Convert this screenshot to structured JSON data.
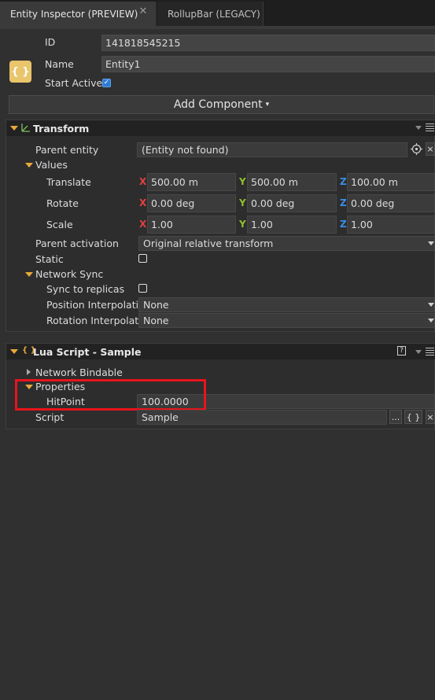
{
  "tabs": [
    {
      "label": "Entity Inspector (PREVIEW)",
      "close": "✕"
    },
    {
      "label": "RollupBar (LEGACY)"
    }
  ],
  "entity": {
    "icon": "{ }",
    "id_label": "ID",
    "id_value": "141818545215",
    "name_label": "Name",
    "name_value": "Entity1",
    "start_active_label": "Start Active",
    "start_active_checked": true
  },
  "add_component": {
    "label": "Add Component",
    "arrow": "▾"
  },
  "transform": {
    "title": "Transform",
    "parent_entity_label": "Parent entity",
    "parent_entity_value": "(Entity not found)",
    "clear": "×",
    "values_label": "Values",
    "rows": [
      {
        "label": "Translate",
        "x": "500.00 m",
        "y": "500.00 m",
        "z": "100.00 m"
      },
      {
        "label": "Rotate",
        "x": "0.00 deg",
        "y": "0.00 deg",
        "z": "0.00 deg"
      },
      {
        "label": "Scale",
        "x": "1.00",
        "y": "1.00",
        "z": "1.00"
      }
    ],
    "axis_x": "X",
    "axis_y": "Y",
    "axis_z": "Z",
    "parent_activation_label": "Parent activation",
    "parent_activation_value": "Original relative transform",
    "static_label": "Static",
    "network_sync_label": "Network Sync",
    "sync_label": "Sync to replicas",
    "pos_interp_label": "Position Interpolation",
    "pos_interp_value": "None",
    "rot_interp_label": "Rotation Interpolation",
    "rot_interp_value": "None"
  },
  "lua": {
    "title": "Lua Script - Sample",
    "help": "?",
    "network_bindable_label": "Network Bindable",
    "properties_label": "Properties",
    "hitpoint_label": "HitPoint",
    "hitpoint_value": "100.0000",
    "script_label": "Script",
    "script_value": "Sample",
    "browse": "...",
    "edit": "{ }",
    "clear": "×"
  },
  "colors": {
    "accent_orange": "#e8a83a",
    "axis_x": "#e04040",
    "axis_y": "#90c030",
    "axis_z": "#3a8ee6",
    "highlight": "#e8141c"
  }
}
